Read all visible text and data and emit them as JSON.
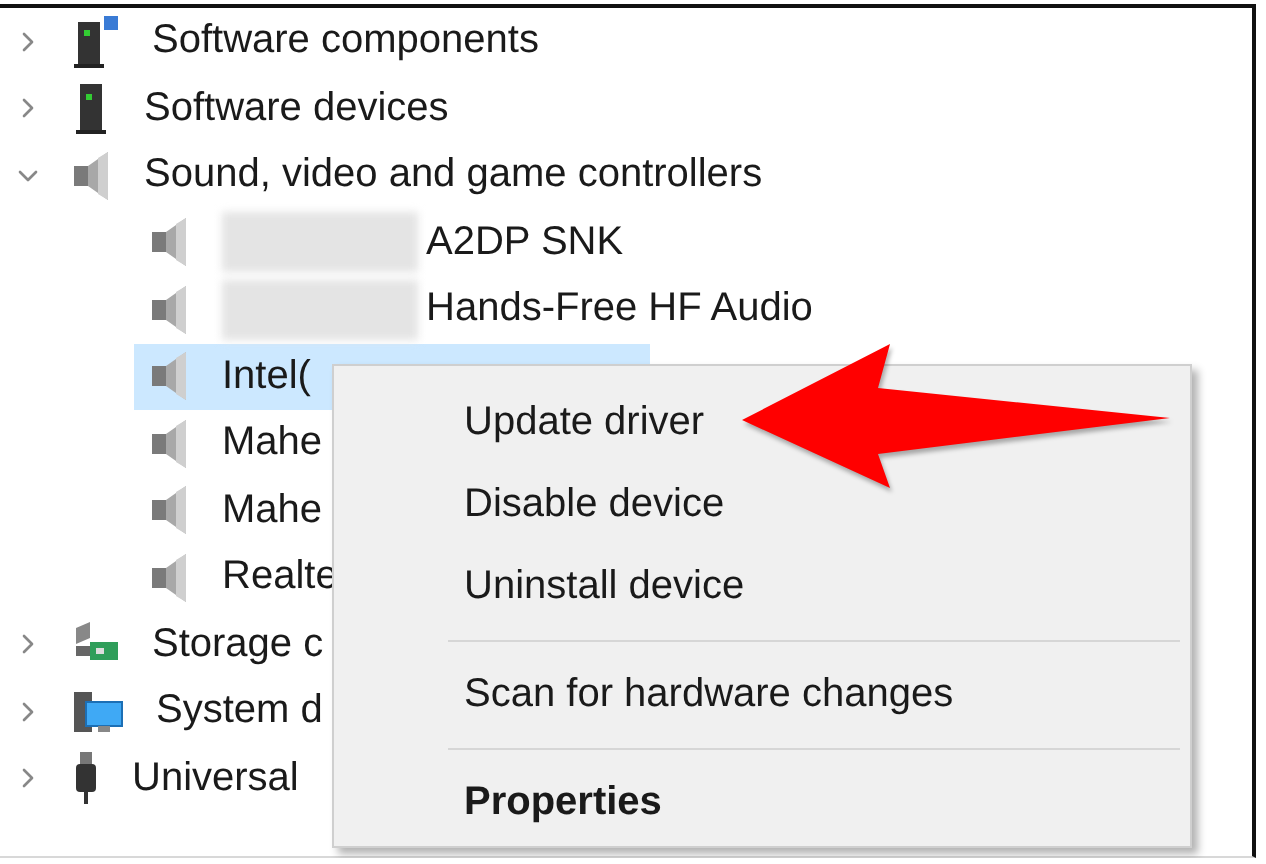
{
  "tree": [
    {
      "label": "Software components",
      "kind": "software-component",
      "expanded": false,
      "selected": false
    },
    {
      "label": "Software devices",
      "kind": "software-device",
      "expanded": false,
      "selected": false
    },
    {
      "label": "Sound, video and game controllers",
      "kind": "speaker",
      "expanded": true,
      "selected": false,
      "children": [
        {
          "label": "A2DP SNK",
          "kind": "speaker",
          "redacted": true,
          "selected": false
        },
        {
          "label": "Hands-Free HF Audio",
          "kind": "speaker",
          "redacted": true,
          "selected": false
        },
        {
          "label": "Intel(",
          "kind": "speaker",
          "redacted": false,
          "selected": true
        },
        {
          "label": "Mahe",
          "kind": "speaker",
          "redacted": false,
          "selected": false
        },
        {
          "label": "Mahe",
          "kind": "speaker",
          "redacted": false,
          "selected": false
        },
        {
          "label": "Realte",
          "kind": "speaker",
          "redacted": false,
          "selected": false
        }
      ]
    },
    {
      "label": "Storage c",
      "kind": "storage",
      "expanded": false,
      "selected": false
    },
    {
      "label": "System d",
      "kind": "system",
      "expanded": false,
      "selected": false
    },
    {
      "label": "Universal",
      "kind": "usb",
      "expanded": false,
      "selected": false
    }
  ],
  "context_menu": {
    "items": [
      {
        "kind": "item",
        "label": "Update driver",
        "default": false
      },
      {
        "kind": "item",
        "label": "Disable device",
        "default": false
      },
      {
        "kind": "item",
        "label": "Uninstall device",
        "default": false
      },
      {
        "kind": "separator"
      },
      {
        "kind": "item",
        "label": "Scan for hardware changes",
        "default": false
      },
      {
        "kind": "separator"
      },
      {
        "kind": "item",
        "label": "Properties",
        "default": true
      }
    ]
  }
}
